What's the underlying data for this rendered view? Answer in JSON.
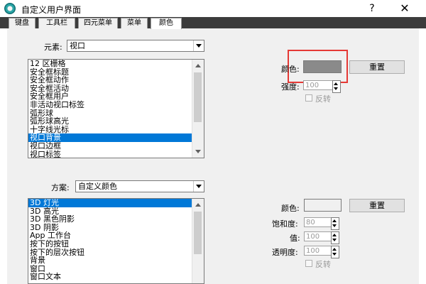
{
  "window": {
    "title": "自定义用户界面",
    "help_label": "?",
    "close_label": "✕",
    "icon": "app-logo-icon"
  },
  "tabs": [
    {
      "label": "键盘"
    },
    {
      "label": "工具栏"
    },
    {
      "label": "四元菜单"
    },
    {
      "label": "菜单"
    },
    {
      "label": "颜色"
    }
  ],
  "elements": {
    "label": "元素:",
    "selected": "视口",
    "items": [
      "12 区栅格",
      "安全框标题",
      "安全框动作",
      "安全框活动",
      "安全框用户",
      "非活动视口标签",
      "弧形球",
      "弧形球高光",
      "十字线光标",
      "视口背景",
      "视口边框",
      "视口标签"
    ],
    "selected_index": 9
  },
  "element_color": {
    "color_label": "颜色:",
    "swatch_color": "#8a8a8a",
    "reset_label": "重置",
    "intensity_label": "强度:",
    "intensity_value": "100",
    "invert_label": "反转"
  },
  "scheme": {
    "label": "方案:",
    "selected": "自定义颜色",
    "items": [
      "3D 灯光",
      "3D 高光",
      "3D 黑色阴影",
      "3D 阴影",
      "App 工作台",
      "按下的按钮",
      "按下的层次按钮",
      "背景",
      "窗口",
      "窗口文本"
    ],
    "selected_index": 0
  },
  "scheme_color": {
    "color_label": "颜色:",
    "swatch_color": "#f0f0f0",
    "reset_label": "重置",
    "saturation_label": "饱和度:",
    "saturation_value": "80",
    "value_label": "值:",
    "value_value": "100",
    "transparency_label": "透明度:",
    "transparency_value": "100",
    "invert_label": "反转"
  },
  "colors": {
    "selection": "#0078d7",
    "highlight_box": "#e53935"
  }
}
